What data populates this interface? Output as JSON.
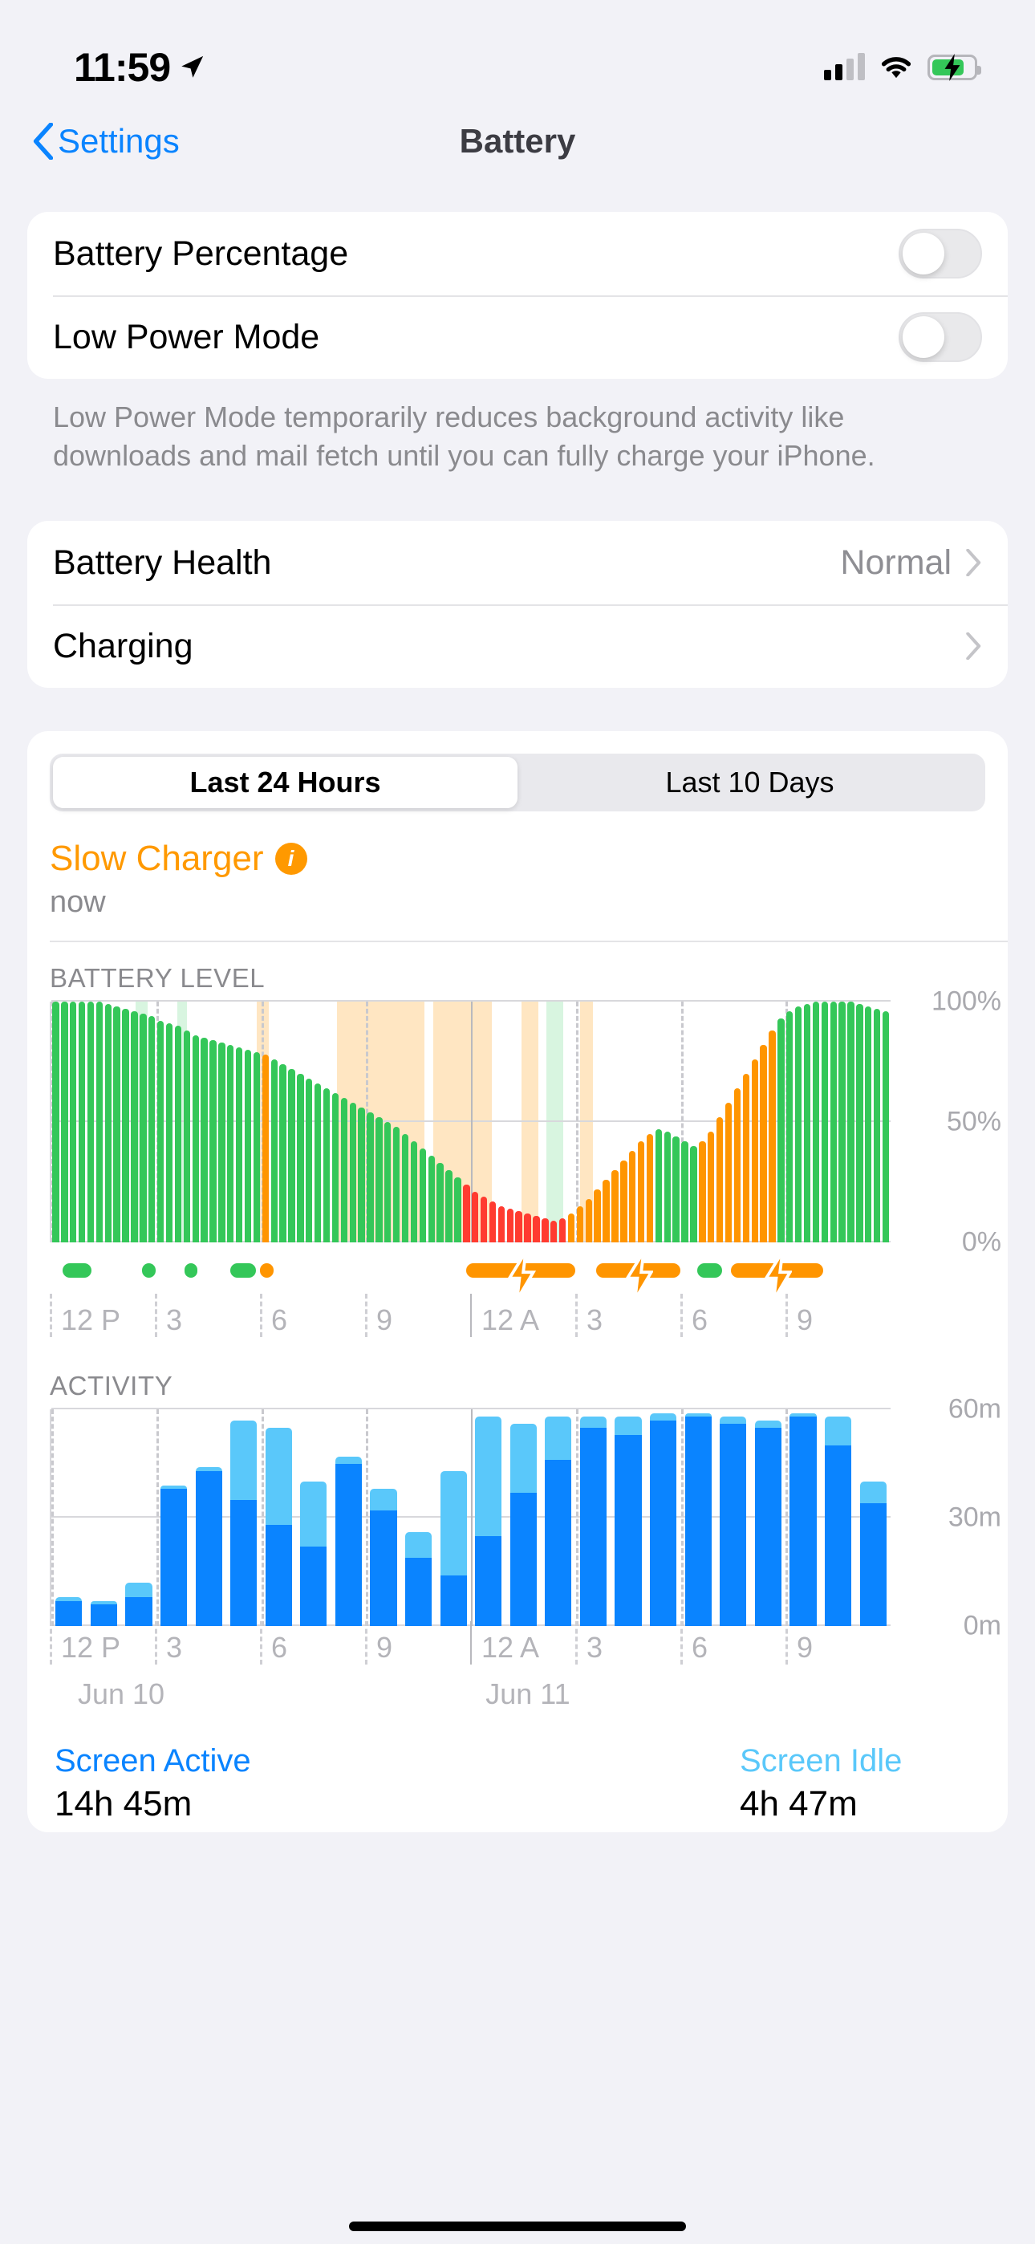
{
  "status_bar": {
    "time": "11:59",
    "location_icon": "location-arrow-icon",
    "signal_icon": "cellular-signal-icon",
    "wifi_icon": "wifi-icon",
    "battery_icon": "battery-charging-icon"
  },
  "nav": {
    "back_label": "Settings",
    "title": "Battery"
  },
  "settings": {
    "battery_percentage_label": "Battery Percentage",
    "battery_percentage_on": false,
    "low_power_label": "Low Power Mode",
    "low_power_on": false,
    "footnote": "Low Power Mode temporarily reduces background activity like downloads and mail fetch until you can fully charge your iPhone.",
    "battery_health_label": "Battery Health",
    "battery_health_value": "Normal",
    "charging_label": "Charging"
  },
  "usage": {
    "segments": [
      {
        "label": "Last 24 Hours",
        "selected": true
      },
      {
        "label": "Last 10 Days",
        "selected": false
      }
    ],
    "charger_status": "Slow Charger",
    "charger_info_icon": "info-circle-icon",
    "charger_time": "now"
  },
  "legend": {
    "screen_active_label": "Screen Active",
    "screen_active_value": "14h 45m",
    "screen_idle_label": "Screen Idle",
    "screen_idle_value": "4h 47m"
  },
  "colors": {
    "accent_blue": "#0a84ff",
    "green": "#34c759",
    "orange": "#ff9500",
    "red": "#ff3b30",
    "light_blue": "#5ac8fa",
    "gray_text": "#8a8a8e"
  },
  "chart_data": [
    {
      "type": "bar",
      "title": "BATTERY LEVEL",
      "xlabel": "",
      "ylabel": "",
      "ylim": [
        0,
        100
      ],
      "ytick_labels": [
        "100%",
        "50%",
        "0%"
      ],
      "ytick_values": [
        100,
        50,
        0
      ],
      "xtick_labels": [
        "12 P",
        "3",
        "6",
        "9",
        "12 A",
        "3",
        "6",
        "9"
      ],
      "xtick_positions": [
        0,
        3,
        6,
        9,
        12,
        15,
        18,
        21
      ],
      "grid": true,
      "legend_position": "none",
      "series": [
        {
          "name": "Battery Level %",
          "values": [
            100,
            100,
            100,
            100,
            100,
            100,
            99,
            98,
            97,
            96,
            95,
            94,
            92,
            91,
            90,
            88,
            86,
            85,
            84,
            83,
            82,
            81,
            80,
            79,
            78,
            76,
            74,
            72,
            70,
            68,
            66,
            64,
            62,
            60,
            58,
            56,
            54,
            52,
            50,
            48,
            45,
            42,
            39,
            36,
            33,
            30,
            27,
            24,
            21,
            19,
            17,
            15,
            14,
            13,
            12,
            11,
            10,
            9,
            10,
            12,
            15,
            18,
            22,
            26,
            30,
            34,
            38,
            42,
            45,
            47,
            46,
            44,
            42,
            40,
            42,
            46,
            52,
            58,
            64,
            70,
            76,
            82,
            88,
            93,
            96,
            98,
            99,
            100,
            100,
            100,
            100,
            100,
            99,
            98,
            97,
            96
          ],
          "colors": [
            "green",
            "green",
            "green",
            "green",
            "green",
            "green",
            "green",
            "green",
            "green",
            "green",
            "green",
            "green",
            "green",
            "green",
            "green",
            "green",
            "green",
            "green",
            "green",
            "green",
            "green",
            "green",
            "green",
            "green",
            "orange",
            "green",
            "green",
            "green",
            "green",
            "green",
            "green",
            "green",
            "green",
            "green",
            "green",
            "green",
            "green",
            "green",
            "green",
            "green",
            "green",
            "green",
            "green",
            "green",
            "green",
            "green",
            "green",
            "red",
            "red",
            "red",
            "red",
            "red",
            "red",
            "red",
            "red",
            "red",
            "red",
            "red",
            "red",
            "orange",
            "orange",
            "orange",
            "orange",
            "orange",
            "orange",
            "orange",
            "orange",
            "orange",
            "orange",
            "green",
            "green",
            "green",
            "green",
            "green",
            "orange",
            "orange",
            "orange",
            "orange",
            "orange",
            "orange",
            "orange",
            "orange",
            "orange",
            "green",
            "green",
            "green",
            "green",
            "green",
            "green",
            "green",
            "green",
            "green",
            "green",
            "green",
            "green",
            "green"
          ]
        }
      ],
      "charge_bands": [
        {
          "start_pct": 24.5,
          "width_pct": 1.4,
          "color": "#ffe6c2"
        },
        {
          "start_pct": 34.0,
          "width_pct": 10.5,
          "color": "#ffe6c2"
        },
        {
          "start_pct": 45.5,
          "width_pct": 7.0,
          "color": "#ffe6c2"
        },
        {
          "start_pct": 56.0,
          "width_pct": 2.0,
          "color": "#ffe6c2"
        },
        {
          "start_pct": 59.0,
          "width_pct": 2.0,
          "color": "#d8f5e0"
        },
        {
          "start_pct": 63.0,
          "width_pct": 1.5,
          "color": "#ffe6c2"
        },
        {
          "start_pct": 10.0,
          "width_pct": 1.5,
          "color": "#d8f5e0"
        },
        {
          "start_pct": 15.0,
          "width_pct": 1.2,
          "color": "#d8f5e0"
        }
      ],
      "charge_markers": [
        {
          "start_pct": 1.5,
          "width_pct": 3.5,
          "color": "#34c759",
          "icon": "none"
        },
        {
          "start_pct": 11.0,
          "width_pct": 1.6,
          "color": "#34c759",
          "icon": "none"
        },
        {
          "start_pct": 16.0,
          "width_pct": 1.6,
          "color": "#34c759",
          "icon": "none"
        },
        {
          "start_pct": 21.5,
          "width_pct": 3.0,
          "color": "#34c759",
          "icon": "none"
        },
        {
          "start_pct": 25.0,
          "width_pct": 1.6,
          "color": "#ff9500",
          "icon": "none"
        },
        {
          "start_pct": 49.5,
          "width_pct": 13.0,
          "color": "#ff9500",
          "icon": "bolt"
        },
        {
          "start_pct": 65.0,
          "width_pct": 10.0,
          "color": "#ff9500",
          "icon": "bolt"
        },
        {
          "start_pct": 77.0,
          "width_pct": 3.0,
          "color": "#34c759",
          "icon": "none"
        },
        {
          "start_pct": 81.0,
          "width_pct": 11.0,
          "color": "#ff9500",
          "icon": "bolt"
        }
      ]
    },
    {
      "type": "bar",
      "title": "ACTIVITY",
      "xlabel": "",
      "ylabel": "",
      "ylim": [
        0,
        60
      ],
      "ytick_labels": [
        "60m",
        "30m",
        "0m"
      ],
      "ytick_values": [
        60,
        30,
        0
      ],
      "xtick_labels": [
        "12 P",
        "3",
        "6",
        "9",
        "12 A",
        "3",
        "6",
        "9"
      ],
      "xtick_positions": [
        0,
        3,
        6,
        9,
        12,
        15,
        18,
        21
      ],
      "day_labels": [
        {
          "label": "Jun 10",
          "pos_pct": 2
        },
        {
          "label": "Jun 11",
          "pos_pct": 50.5
        }
      ],
      "grid": true,
      "legend_position": "bottom",
      "categories": [
        "12P",
        "1P",
        "2P",
        "3P",
        "4P",
        "5P",
        "6P",
        "7P",
        "8P",
        "9P",
        "10P",
        "11P",
        "12A",
        "1A",
        "2A",
        "3A",
        "4A",
        "5A",
        "6A",
        "7A",
        "8A",
        "9A",
        "10A",
        "11A"
      ],
      "series": [
        {
          "name": "Screen Active",
          "color": "#0a84ff",
          "values": [
            7,
            6,
            8,
            38,
            43,
            35,
            28,
            22,
            45,
            32,
            19,
            14,
            25,
            37,
            46,
            55,
            53,
            57,
            58,
            56,
            55,
            58,
            50,
            34
          ]
        },
        {
          "name": "Screen Idle",
          "color": "#5ac8fa",
          "values": [
            1,
            1,
            4,
            1,
            1,
            22,
            27,
            18,
            2,
            6,
            7,
            29,
            33,
            19,
            12,
            3,
            5,
            2,
            1,
            2,
            2,
            1,
            8,
            6
          ]
        }
      ]
    }
  ]
}
